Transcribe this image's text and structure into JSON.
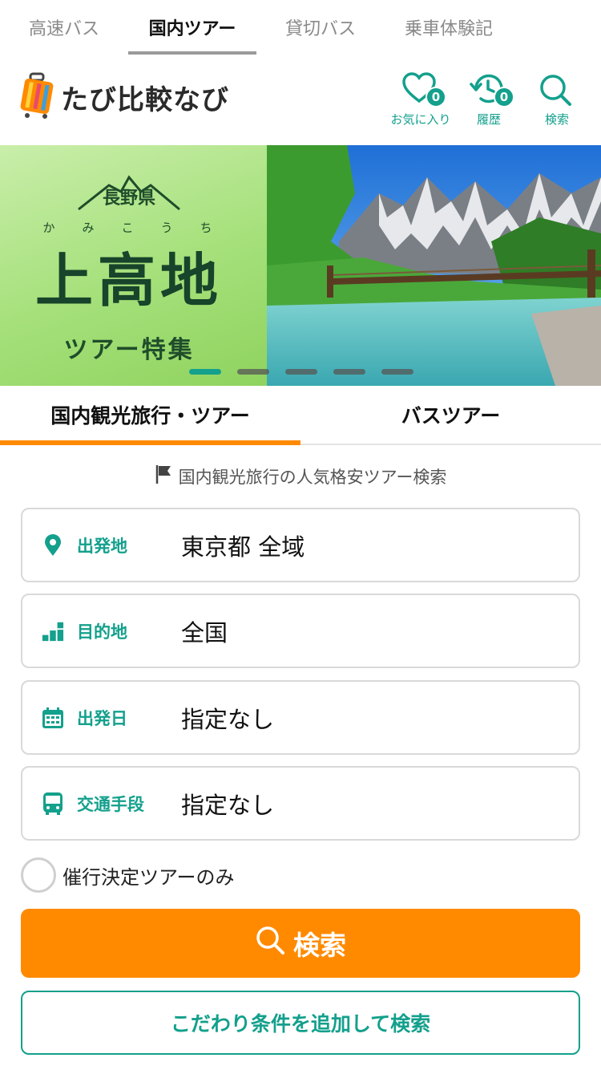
{
  "top_tabs": [
    {
      "label": "高速バス",
      "active": false
    },
    {
      "label": "国内ツアー",
      "active": true
    },
    {
      "label": "貸切バス",
      "active": false
    },
    {
      "label": "乗車体験記",
      "active": false
    }
  ],
  "header": {
    "logo_text": "たび比較なび",
    "favorites": {
      "label": "お気に入り",
      "count": "0"
    },
    "history": {
      "label": "履歴",
      "count": "0"
    },
    "search": {
      "label": "検索"
    }
  },
  "banner": {
    "prefecture": "長野県",
    "kana": "かみこうち",
    "title": "上高地",
    "subtitle": "ツアー特集",
    "slide_count": 5,
    "active_slide": 1
  },
  "category_tabs": [
    {
      "label": "国内観光旅行・ツアー",
      "active": true
    },
    {
      "label": "バスツアー",
      "active": false
    }
  ],
  "search_form": {
    "caption": "国内観光旅行の人気格安ツアー検索",
    "fields": [
      {
        "icon": "location-pin-icon",
        "label": "出発地",
        "value": "東京都 全域"
      },
      {
        "icon": "destination-icon",
        "label": "目的地",
        "value": "全国"
      },
      {
        "icon": "calendar-icon",
        "label": "出発日",
        "value": "指定なし"
      },
      {
        "icon": "bus-icon",
        "label": "交通手段",
        "value": "指定なし"
      }
    ],
    "guaranteed_only_label": "催行決定ツアーのみ",
    "search_button": "検索",
    "detail_search_button": "こだわり条件を追加して検索"
  },
  "colors": {
    "accent_teal": "#13a08c",
    "accent_orange": "#ff8a00"
  }
}
